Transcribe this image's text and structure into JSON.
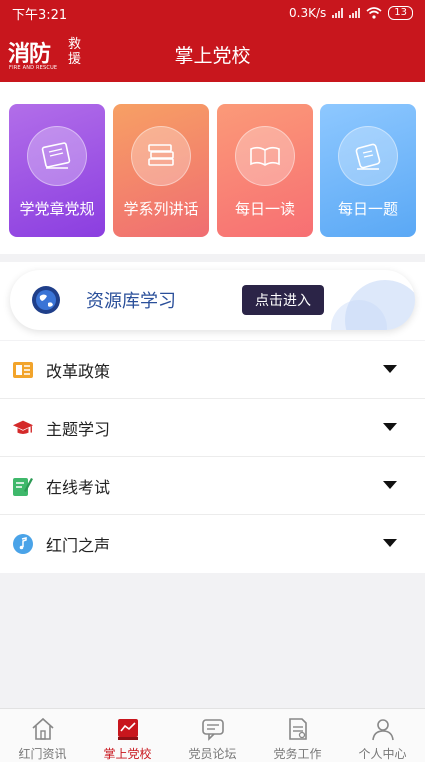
{
  "status": {
    "time": "下午3:21",
    "speed": "0.3K/s",
    "battery": "13"
  },
  "header": {
    "logo_text": "消防",
    "logo_small": "救援",
    "logo_en": "FIRE AND RESCUE",
    "title": "掌上党校"
  },
  "cards": [
    {
      "label": "学党章党规",
      "icon": "book-icon"
    },
    {
      "label": "学系列讲话",
      "icon": "books-stack-icon"
    },
    {
      "label": "每日一读",
      "icon": "open-book-icon"
    },
    {
      "label": "每日一题",
      "icon": "phone-quiz-icon"
    }
  ],
  "resource": {
    "label": "资源库学习",
    "button": "点击进入"
  },
  "menu": [
    {
      "label": "改革政策",
      "icon": "policy-book-icon",
      "color": "#f2a42b"
    },
    {
      "label": "主题学习",
      "icon": "graduation-cap-icon",
      "color": "#d42a2a"
    },
    {
      "label": "在线考试",
      "icon": "pencil-paper-icon",
      "color": "#3fb86b"
    },
    {
      "label": "红门之声",
      "icon": "music-note-icon",
      "color": "#4aa3e8"
    }
  ],
  "tabs": [
    {
      "label": "红门资讯",
      "active": false
    },
    {
      "label": "掌上党校",
      "active": true
    },
    {
      "label": "党员论坛",
      "active": false
    },
    {
      "label": "党务工作",
      "active": false
    },
    {
      "label": "个人中心",
      "active": false
    }
  ],
  "colors": {
    "brand": "#c8161d",
    "resource_button": "#2b2447",
    "resource_text": "#2a4f9a"
  }
}
